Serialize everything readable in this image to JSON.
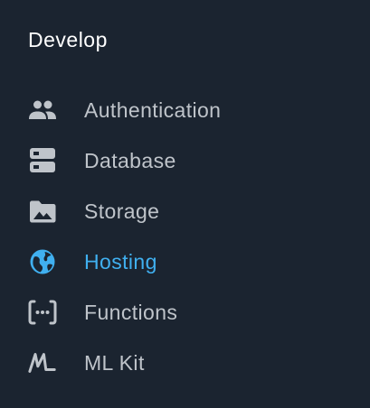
{
  "section": {
    "title": "Develop"
  },
  "colors": {
    "background": "#1b2430",
    "text": "#bfc4ca",
    "icon": "#bfc4ca",
    "active": "#40b0f0",
    "title": "#ffffff"
  },
  "nav": {
    "items": [
      {
        "label": "Authentication",
        "icon": "people-icon",
        "active": false
      },
      {
        "label": "Database",
        "icon": "database-icon",
        "active": false
      },
      {
        "label": "Storage",
        "icon": "folder-image-icon",
        "active": false
      },
      {
        "label": "Hosting",
        "icon": "globe-icon",
        "active": true
      },
      {
        "label": "Functions",
        "icon": "functions-icon",
        "active": false
      },
      {
        "label": "ML Kit",
        "icon": "ml-kit-icon",
        "active": false
      }
    ]
  }
}
